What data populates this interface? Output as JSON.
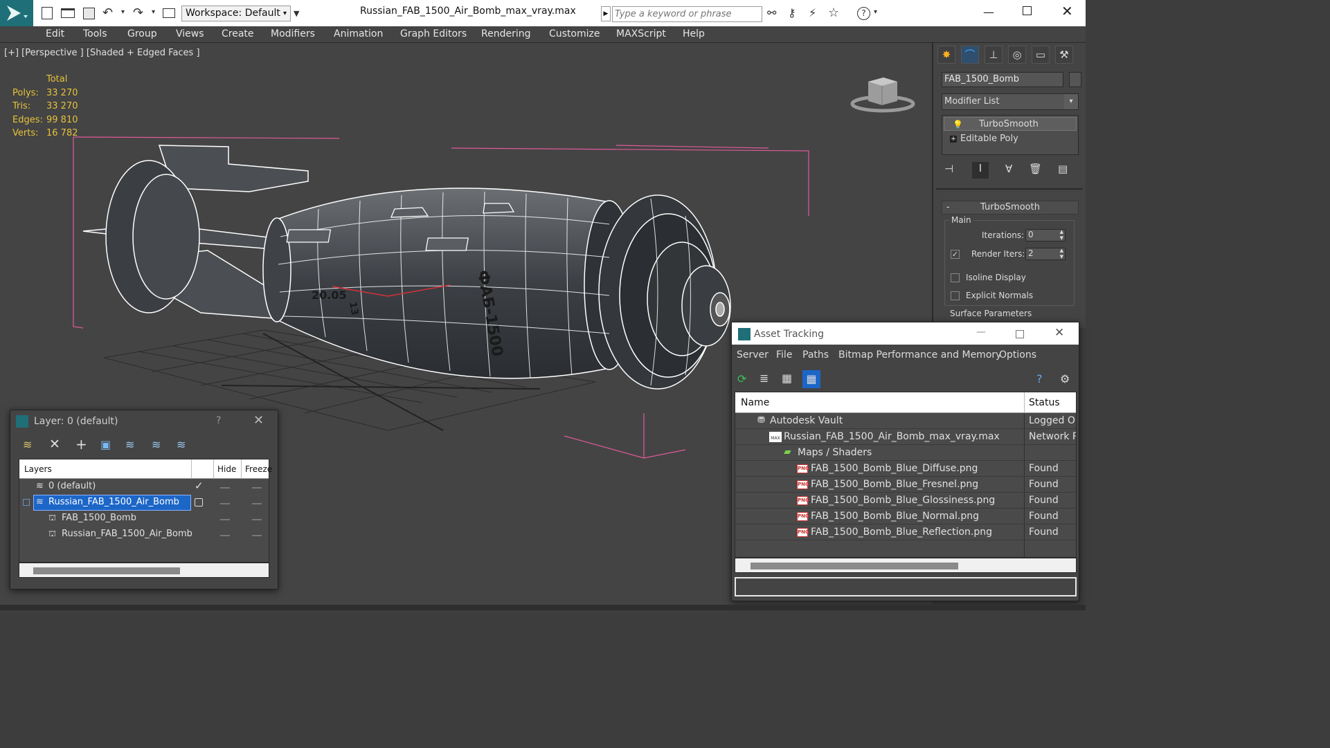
{
  "titlebar": {
    "workspace": "Workspace: Default",
    "file_title": "Russian_FAB_1500_Air_Bomb_max_vray.max",
    "search_placeholder": "Type a keyword or phrase"
  },
  "menu": [
    "Edit",
    "Tools",
    "Group",
    "Views",
    "Create",
    "Modifiers",
    "Animation",
    "Graph Editors",
    "Rendering",
    "Customize",
    "MAXScript",
    "Help"
  ],
  "viewport": {
    "label": "[+] [Perspective ] [Shaded + Edged Faces ]",
    "stats": {
      "header": "Total",
      "polys_label": "Polys:",
      "polys": "33 270",
      "tris_label": "Tris:",
      "tris": "33 270",
      "edges_label": "Edges:",
      "edges": "99 810",
      "verts_label": "Verts:",
      "verts": "16 782"
    },
    "bomb_markings": [
      "ФАБ-1500",
      "20.05",
      "13"
    ]
  },
  "command_panel": {
    "object_name": "FAB_1500_Bomb",
    "modifier_list": "Modifier List",
    "stack": [
      "TurboSmooth",
      "Editable Poly"
    ],
    "rollout_title": "TurboSmooth",
    "group_main": "Main",
    "iterations_label": "Iterations:",
    "iterations": "0",
    "render_iters_label": "Render Iters:",
    "render_iters": "2",
    "isoline": "Isoline Display",
    "explicit_normals": "Explicit Normals",
    "surface_params": "Surface Parameters"
  },
  "layer_window": {
    "title": "Layer: 0 (default)",
    "help": "?",
    "col_layers": "Layers",
    "col_hide": "Hide",
    "col_freeze": "Freeze",
    "rows": [
      {
        "name": "0 (default)"
      },
      {
        "name": "Russian_FAB_1500_Air_Bomb"
      },
      {
        "name": "FAB_1500_Bomb"
      },
      {
        "name": "Russian_FAB_1500_Air_Bomb"
      }
    ]
  },
  "asset_window": {
    "title": "Asset Tracking",
    "menus": [
      "Server",
      "File",
      "Paths",
      "Bitmap Performance and Memory",
      "Options"
    ],
    "col_name": "Name",
    "col_status": "Status",
    "rows": [
      {
        "name": "Autodesk Vault",
        "status": "Logged Ou"
      },
      {
        "name": "Russian_FAB_1500_Air_Bomb_max_vray.max",
        "status": "Network Pa"
      },
      {
        "name": "Maps / Shaders",
        "status": ""
      },
      {
        "name": "FAB_1500_Bomb_Blue_Diffuse.png",
        "status": "Found"
      },
      {
        "name": "FAB_1500_Bomb_Blue_Fresnel.png",
        "status": "Found"
      },
      {
        "name": "FAB_1500_Bomb_Blue_Glossiness.png",
        "status": "Found"
      },
      {
        "name": "FAB_1500_Bomb_Blue_Normal.png",
        "status": "Found"
      },
      {
        "name": "FAB_1500_Bomb_Blue_Reflection.png",
        "status": "Found"
      }
    ]
  },
  "colors": {
    "stats_yellow": "#e8c23a",
    "selection_blue": "#1c66c8",
    "bbox_pink": "#e05a9a"
  }
}
